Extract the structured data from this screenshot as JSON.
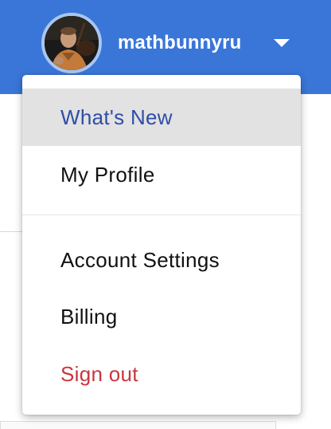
{
  "header": {
    "username": "mathbunnyru",
    "avatar_alt": "user avatar",
    "accent_color": "#3a76d8"
  },
  "menu": {
    "items": [
      {
        "label": "What's New",
        "state": "highlighted"
      },
      {
        "label": "My Profile",
        "state": "normal"
      },
      {
        "label": "Account Settings",
        "state": "normal"
      },
      {
        "label": "Billing",
        "state": "normal"
      },
      {
        "label": "Sign out",
        "state": "danger"
      }
    ],
    "colors": {
      "highlight_bg": "#e2e2e2",
      "highlight_text": "#2f4da8",
      "signout_text": "#c8363d"
    }
  }
}
